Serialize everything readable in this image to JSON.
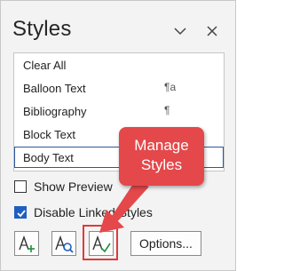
{
  "pane": {
    "title": "Styles",
    "header_icons": [
      "chevron-down-icon",
      "close-icon"
    ]
  },
  "styles_list": [
    {
      "label": "Clear All",
      "mark": ""
    },
    {
      "label": "Balloon Text",
      "mark": "¶a"
    },
    {
      "label": "Bibliography",
      "mark": "¶"
    },
    {
      "label": "Block Text",
      "mark": ""
    },
    {
      "label": "Body Text",
      "mark": "",
      "selected": true
    }
  ],
  "options": {
    "show_preview": {
      "label": "Show Preview",
      "checked": false
    },
    "disable_linked_styles": {
      "label": "Disable Linked Styles",
      "checked": true
    }
  },
  "toolbar": {
    "new_style_icon": "new-style-icon",
    "style_inspector_icon": "style-inspector-icon",
    "manage_styles_icon": "manage-styles-icon",
    "options_label": "Options..."
  },
  "callout": {
    "line1": "Manage",
    "line2": "Styles"
  },
  "colors": {
    "accent": "#1f5fbf",
    "callout": "#e4484a",
    "highlight": "#e03a3a",
    "manage_check": "#1e8f3e",
    "new_plus": "#1e8f3e",
    "inspector_glass": "#1f5fbf"
  }
}
